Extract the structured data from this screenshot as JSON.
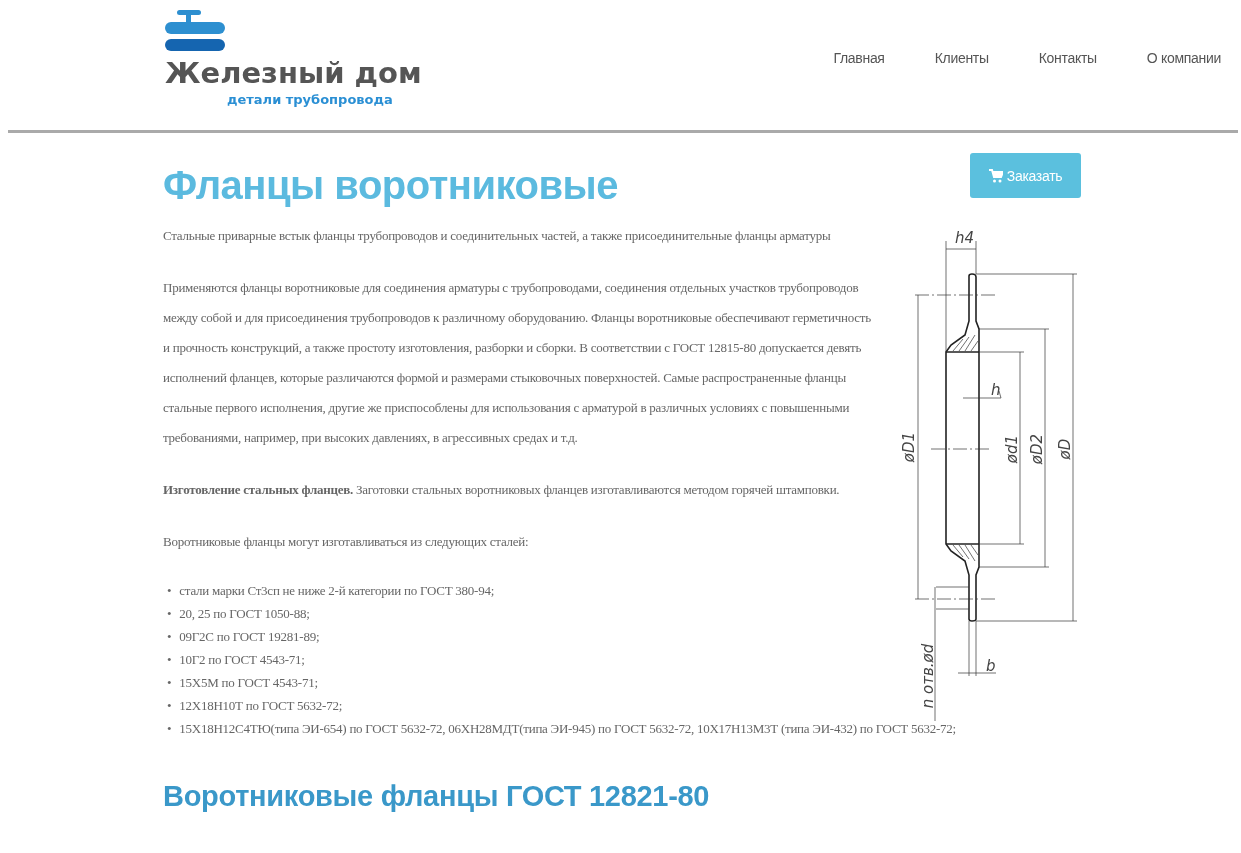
{
  "header": {
    "logo": {
      "name": "Железный дом",
      "tagline": "детали трубопровода"
    },
    "nav": [
      {
        "label": "Главная"
      },
      {
        "label": "Клиенты"
      },
      {
        "label": "Контакты"
      },
      {
        "label": "О компании"
      }
    ]
  },
  "page": {
    "title": "Фланцы воротниковые",
    "order_button": "Заказать",
    "intro": "Стальные приварные встык фланцы трубопроводов и соединительных частей, а также присоединительные фланцы арматуры",
    "description": "Применяются фланцы воротниковые для соединения арматуры с трубопроводами, соединения отдельных участков трубопроводов между собой и для присоединения трубопроводов к различному оборудованию. Фланцы воротниковые обеспечивают герметичность и прочность конструкций, а также простоту изготовления, разборки и сборки. В соответствии с ГОСТ 12815-80 допускается девять исполнений фланцев, которые различаются формой и размерами стыковочных поверхностей. Самые распространенные фланцы стальные первого исполнения, другие же приспособлены для использования с арматурой в различных условиях с повышенными требованиями, например, при высоких давлениях, в агрессивных средах и т.д.",
    "manufacturing": "**Изготовление стальных фланцев.** Заготовки стальных воротниковых фланцев изготавливаются методом горячей штамповки.",
    "steels_intro": "Воротниковые фланцы могут изготавливаться из следующих сталей:",
    "bullet": "•",
    "steels": [
      "стали марки Ст3сп не ниже 2-й категории по ГОСТ 380-94;",
      "20, 25 по ГОСТ 1050-88;",
      "09Г2С по ГОСТ 19281-89;",
      "10Г2 по ГОСТ 4543-71;",
      "15Х5М по ГОСТ 4543-71;",
      "12Х18Н10Т по ГОСТ 5632-72;",
      "15Х18Н12С4ТЮ(типа ЭИ-654) по ГОСТ 5632-72, 06ХН28МДТ(типа ЭИ-945) по ГОСТ 5632-72, 10Х17Н13М3Т (типа ЭИ-432) по ГОСТ 5632-72;"
    ],
    "drawing": {
      "labels": [
        {
          "kind": "h4",
          "text": "h4"
        },
        {
          "kind": "D1",
          "text": "øD1"
        },
        {
          "kind": "h",
          "text": "h"
        },
        {
          "kind": "d1",
          "text": "ød1"
        },
        {
          "kind": "D2",
          "text": "øD2"
        },
        {
          "kind": "D",
          "text": "øD"
        },
        {
          "kind": "holes",
          "text": "n отв.ød"
        },
        {
          "kind": "b",
          "text": "b"
        }
      ]
    },
    "subtitle": "Воротниковые фланцы ГОСТ 12821-80"
  }
}
